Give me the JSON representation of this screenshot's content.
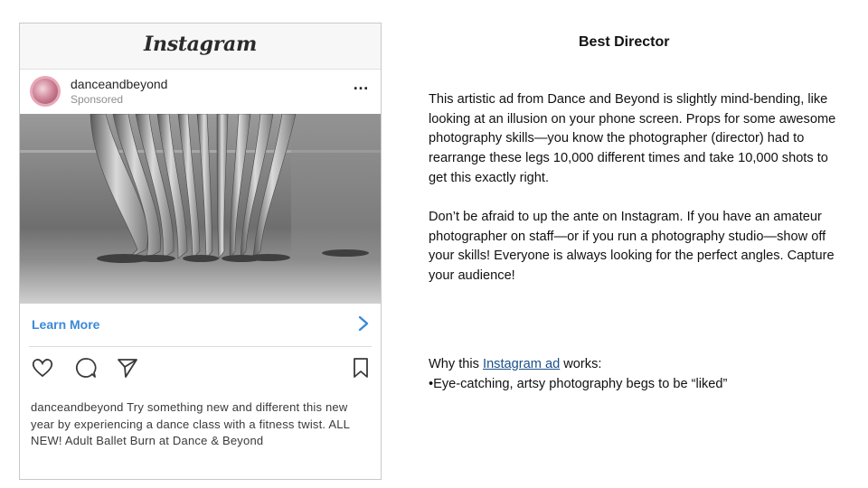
{
  "instagram_post": {
    "logo": "Instagram",
    "username": "danceandbeyond",
    "sponsored": "Sponsored",
    "more": "…",
    "cta_label": "Learn More",
    "caption_user": "danceandbeyond",
    "caption_text": "Try something new and different this new year by experiencing a dance class with a fitness twist. ALL NEW! Adult Ballet Burn at Dance & Beyond"
  },
  "slide": {
    "title": "Best Director",
    "paragraph1": "This artistic ad from Dance and Beyond is slightly mind-bending, like looking at an illusion on your phone screen. Props for some awesome photography skills—you know the photographer (director) had to rearrange these legs 10,000 different times and take 10,000 shots to get this exactly right.",
    "paragraph2": "Don’t be afraid to up the ante on Instagram. If you have an amateur photographer on staff—or if you run a photography studio—show off your skills! Everyone is always looking for the perfect angles. Capture your audience!",
    "why_prefix": "Why this ",
    "why_link": "Instagram ad",
    "why_suffix": " works:",
    "bullet": "•Eye-catching, artsy photography begs to be “liked”"
  },
  "colors": {
    "link": "#1a4f8a",
    "cta": "#3a8ad6",
    "text": "#111111"
  }
}
